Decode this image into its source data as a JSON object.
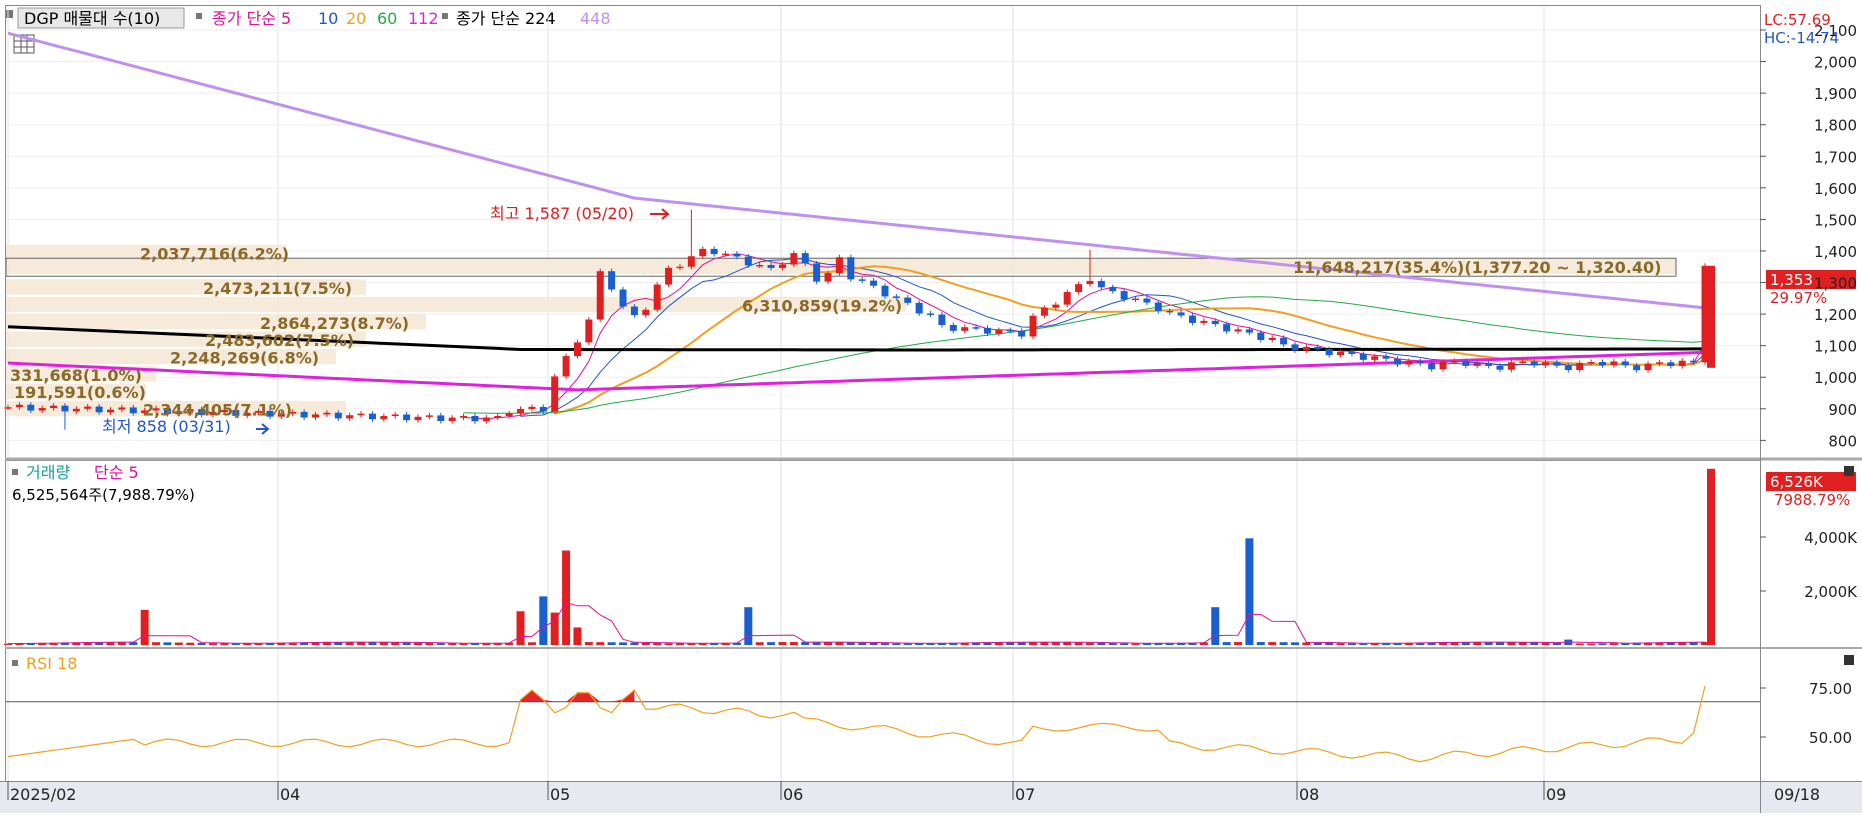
{
  "window": {
    "title": "DGP 매물대 수(10)"
  },
  "price_panel": {
    "legend": [
      {
        "text": "DGP 매물대 수(10)",
        "color": "#000000"
      },
      {
        "text": "종가 단순 5",
        "color": "#e0109a"
      },
      {
        "text": "10",
        "color": "#2255cc"
      },
      {
        "text": "20",
        "color": "#f0a020"
      },
      {
        "text": "60",
        "color": "#22aa44"
      },
      {
        "text": "112",
        "color": "#e020e0"
      },
      {
        "text": "종가 단순 224",
        "color": "#000000"
      },
      {
        "text": "448",
        "color": "#c090f0"
      }
    ],
    "lc_label": "LC:57.69",
    "hc_label": "HC:-14.74",
    "y_ticks": [
      "2,100",
      "2,000",
      "1,900",
      "1,800",
      "1,700",
      "1,600",
      "1,500",
      "1,400",
      "1,300",
      "1,200",
      "1,100",
      "1,000",
      "900",
      "800"
    ],
    "current_price": "1,353",
    "change_pct": "29.97%",
    "high_marker": "최고 1,587 (05/20)",
    "low_marker": "최저 858 (03/31)"
  },
  "volume_panel": {
    "legend_volume": "거래량",
    "legend_ma": "단순 5",
    "summary": "6,525,564주(7,988.79%)",
    "current_value": "6,526K",
    "current_pct": "7988.79%",
    "y_ticks": [
      "4,000K",
      "2,000K"
    ]
  },
  "rsi_panel": {
    "legend": "RSI 18",
    "y_ticks": [
      "75.00",
      "50.00"
    ]
  },
  "x_axis": {
    "labels": [
      "2025/02",
      "04",
      "05",
      "06",
      "07",
      "08",
      "09"
    ],
    "right_label": "09/18"
  },
  "colors": {
    "up": "#e02020",
    "down": "#1a5fd0",
    "profile_fill": "#f5e6d3",
    "profile_text": "#8a6a2a",
    "ma5": "#e0109a",
    "ma10": "#2255cc",
    "ma20": "#f0a020",
    "ma60": "#22aa44",
    "ma112": "#e020e0",
    "ma224": "#000000",
    "ma448": "#c090f0",
    "rsi": "#f0a020",
    "rsi_fill": "#dd1111"
  },
  "chart_data": [
    {
      "type": "candlestick",
      "title": "DGP 매물대 수(10)",
      "x_range": [
        "2025/02",
        "09/18"
      ],
      "ylim": [
        780,
        2120
      ],
      "y_scale": "linear",
      "grid": true,
      "candles": [
        {
          "date": "03/31",
          "close": 858,
          "note": "최저"
        },
        {
          "date": "05/20",
          "high": 1587,
          "note": "최고"
        },
        {
          "date": "09/18",
          "close": 1353
        }
      ],
      "volume_profile": [
        {
          "label": "2,037,716(6.2%)",
          "price_low": 1365,
          "price_high": 1420
        },
        {
          "label": "11,648,217(35.4%)(1,377.20 ~ 1,320.40)",
          "price_low": 1320,
          "price_high": 1377
        },
        {
          "label": "2,473,211(7.5%)",
          "price_low": 1255,
          "price_high": 1310
        },
        {
          "label": "6,310,859(19.2%)",
          "price_low": 1200,
          "price_high": 1255
        },
        {
          "label": "2,864,273(8.7%)",
          "price_low": 1145,
          "price_high": 1200
        },
        {
          "label": "2,483,602(7.5%)",
          "price_low": 1090,
          "price_high": 1145
        },
        {
          "label": "2,248,269(6.8%)",
          "price_low": 1035,
          "price_high": 1090
        },
        {
          "label": "331,668(1.0%)",
          "price_low": 980,
          "price_high": 1035
        },
        {
          "label": "191,591(0.6%)",
          "price_low": 925,
          "price_high": 980
        },
        {
          "label": "2,344,405(7.1%)",
          "price_low": 870,
          "price_high": 925
        }
      ],
      "moving_averages": [
        "종가 단순 5",
        "10",
        "20",
        "60",
        "112",
        "종가 단순 224",
        "448"
      ]
    },
    {
      "type": "bar",
      "title": "거래량",
      "ylim": [
        0,
        7000000
      ],
      "last_value": 6525564,
      "ma_label": "단순 5"
    },
    {
      "type": "line",
      "title": "RSI 18",
      "ylim": [
        30,
        85
      ],
      "reference_line": 68,
      "last_value": 76
    }
  ]
}
